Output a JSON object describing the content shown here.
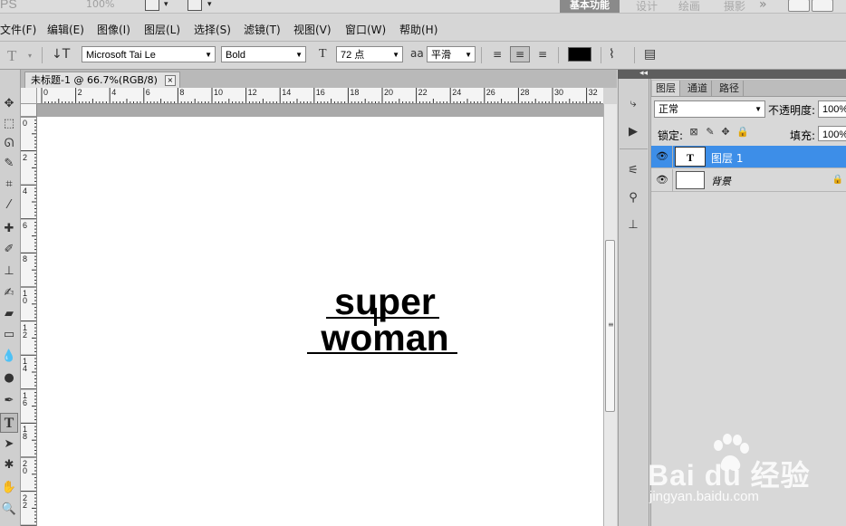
{
  "topbar": {
    "logo": "PS",
    "zoom": "100%",
    "workspaces": [
      "基本功能",
      "设计",
      "绘画",
      "摄影"
    ],
    "more": "»"
  },
  "menu": [
    "文件(F)",
    "编辑(E)",
    "图像(I)",
    "图层(L)",
    "选择(S)",
    "滤镜(T)",
    "视图(V)",
    "窗口(W)",
    "帮助(H)"
  ],
  "options": {
    "tool_glyph": "T",
    "font_family": "Microsoft Tai Le",
    "font_style": "Bold",
    "font_size": "72 点",
    "antialias_icon": "aa",
    "antialias": "平滑",
    "text_color": "#000000"
  },
  "document": {
    "tab_title": "未标题-1 @ 66.7%(RGB/8)",
    "close": "×",
    "text_line1": "super",
    "text_line2": "woman",
    "h_ruler_ticks": [
      "0",
      "2",
      "4",
      "6",
      "8",
      "10",
      "12",
      "14",
      "16",
      "18",
      "20",
      "22",
      "24",
      "26",
      "28",
      "30",
      "32"
    ],
    "v_ruler_ticks": [
      "0",
      "2",
      "4",
      "6",
      "8",
      "10",
      "12",
      "14",
      "16",
      "18",
      "20",
      "22"
    ]
  },
  "layers_panel": {
    "tabs": [
      "图层",
      "通道",
      "路径"
    ],
    "blend_mode": "正常",
    "opacity_label": "不透明度:",
    "opacity": "100%",
    "lock_label": "锁定:",
    "fill_label": "填充:",
    "fill": "100%",
    "layers": [
      {
        "name": "图层 1",
        "thumb": "T",
        "selected": true
      },
      {
        "name": "背景",
        "thumb": "",
        "locked": true
      }
    ]
  },
  "watermark": {
    "brand": "Bai du 经验",
    "url": "jingyan.baidu.com"
  },
  "colors": {
    "selection": "#3d8ee8",
    "ui_bg": "#d4d4d4",
    "active_workspace": "#8a8a8a"
  }
}
